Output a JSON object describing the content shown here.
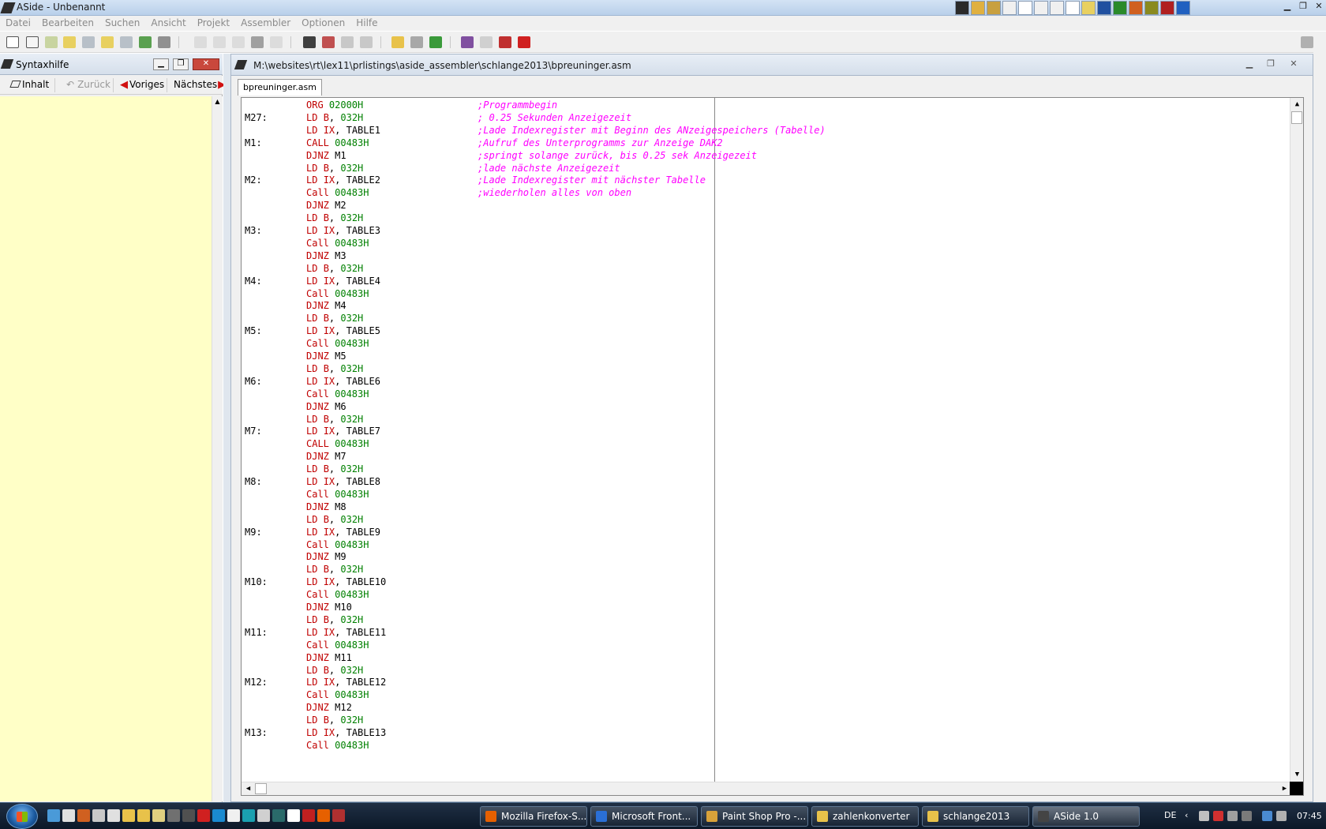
{
  "window": {
    "title": "ASide - Unbenannt"
  },
  "menu": [
    "Datei",
    "Bearbeiten",
    "Suchen",
    "Ansicht",
    "Projekt",
    "Assembler",
    "Optionen",
    "Hilfe"
  ],
  "left_panel": {
    "title": "Syntaxhilfe",
    "buttons": {
      "contents": "Inhalt",
      "back": "Zurück",
      "previous": "Voriges",
      "next": "Nächstes"
    }
  },
  "editor": {
    "path": "M:\\websites\\rt\\lex11\\prlistings\\aside_assembler\\schlange2013\\bpreuninger.asm",
    "tab": "bpreuninger.asm",
    "lines": [
      {
        "label": "",
        "op": "ORG",
        "args": [
          {
            "t": "02000H",
            "c": "num"
          }
        ],
        "comment": ";Programmbegin"
      },
      {
        "label": "M27:",
        "op": "LD",
        "args": [
          {
            "t": "B",
            "c": "reg"
          },
          {
            "t": ", ",
            "c": "plain"
          },
          {
            "t": "032H",
            "c": "num"
          }
        ],
        "comment": "; 0.25 Sekunden Anzeigezeit"
      },
      {
        "label": "",
        "op": "LD",
        "args": [
          {
            "t": "IX",
            "c": "reg"
          },
          {
            "t": ", TABLE1",
            "c": "plain"
          }
        ],
        "comment": ";Lade Indexregister mit Beginn des ANzeigespeichers (Tabelle)"
      },
      {
        "label": "M1:",
        "op": "CALL",
        "args": [
          {
            "t": "00483H",
            "c": "num"
          }
        ],
        "comment": ";Aufruf des Unterprogramms zur Anzeige DAK2"
      },
      {
        "label": "",
        "op": "DJNZ",
        "args": [
          {
            "t": "M1",
            "c": "plain"
          }
        ],
        "comment": ";springt solange zurück, bis 0.25 sek Anzeigezeit"
      },
      {
        "label": "",
        "op": "LD",
        "args": [
          {
            "t": "B",
            "c": "reg"
          },
          {
            "t": ", ",
            "c": "plain"
          },
          {
            "t": "032H",
            "c": "num"
          }
        ],
        "comment": ";lade nächste Anzeigezeit"
      },
      {
        "label": "M2:",
        "op": "LD",
        "args": [
          {
            "t": "IX",
            "c": "reg"
          },
          {
            "t": ", TABLE2",
            "c": "plain"
          }
        ],
        "comment": ";Lade Indexregister mit nächster Tabelle"
      },
      {
        "label": "",
        "op": "Call",
        "args": [
          {
            "t": "00483H",
            "c": "num"
          }
        ],
        "comment": ";wiederholen alles von oben"
      },
      {
        "label": "",
        "op": "DJNZ",
        "args": [
          {
            "t": "M2",
            "c": "plain"
          }
        ],
        "comment": ""
      },
      {
        "label": "",
        "op": "LD",
        "args": [
          {
            "t": "B",
            "c": "reg"
          },
          {
            "t": ", ",
            "c": "plain"
          },
          {
            "t": "032H",
            "c": "num"
          }
        ],
        "comment": ""
      },
      {
        "label": "M3:",
        "op": "LD",
        "args": [
          {
            "t": "IX",
            "c": "reg"
          },
          {
            "t": ", TABLE3",
            "c": "plain"
          }
        ],
        "comment": ""
      },
      {
        "label": "",
        "op": "Call",
        "args": [
          {
            "t": "00483H",
            "c": "num"
          }
        ],
        "comment": ""
      },
      {
        "label": "",
        "op": "DJNZ",
        "args": [
          {
            "t": "M3",
            "c": "plain"
          }
        ],
        "comment": ""
      },
      {
        "label": "",
        "op": "LD",
        "args": [
          {
            "t": "B",
            "c": "reg"
          },
          {
            "t": ", ",
            "c": "plain"
          },
          {
            "t": "032H",
            "c": "num"
          }
        ],
        "comment": ""
      },
      {
        "label": "M4:",
        "op": "LD",
        "args": [
          {
            "t": "IX",
            "c": "reg"
          },
          {
            "t": ", TABLE4",
            "c": "plain"
          }
        ],
        "comment": ""
      },
      {
        "label": "",
        "op": "Call",
        "args": [
          {
            "t": "00483H",
            "c": "num"
          }
        ],
        "comment": ""
      },
      {
        "label": "",
        "op": "DJNZ",
        "args": [
          {
            "t": "M4",
            "c": "plain"
          }
        ],
        "comment": ""
      },
      {
        "label": "",
        "op": "LD",
        "args": [
          {
            "t": "B",
            "c": "reg"
          },
          {
            "t": ", ",
            "c": "plain"
          },
          {
            "t": "032H",
            "c": "num"
          }
        ],
        "comment": ""
      },
      {
        "label": "M5:",
        "op": "LD",
        "args": [
          {
            "t": "IX",
            "c": "reg"
          },
          {
            "t": ", TABLE5",
            "c": "plain"
          }
        ],
        "comment": ""
      },
      {
        "label": "",
        "op": "Call",
        "args": [
          {
            "t": "00483H",
            "c": "num"
          }
        ],
        "comment": ""
      },
      {
        "label": "",
        "op": "DJNZ",
        "args": [
          {
            "t": "M5",
            "c": "plain"
          }
        ],
        "comment": ""
      },
      {
        "label": "",
        "op": "LD",
        "args": [
          {
            "t": "B",
            "c": "reg"
          },
          {
            "t": ", ",
            "c": "plain"
          },
          {
            "t": "032H",
            "c": "num"
          }
        ],
        "comment": ""
      },
      {
        "label": "M6:",
        "op": "LD",
        "args": [
          {
            "t": "IX",
            "c": "reg"
          },
          {
            "t": ", TABLE6",
            "c": "plain"
          }
        ],
        "comment": ""
      },
      {
        "label": "",
        "op": "Call",
        "args": [
          {
            "t": "00483H",
            "c": "num"
          }
        ],
        "comment": ""
      },
      {
        "label": "",
        "op": "DJNZ",
        "args": [
          {
            "t": "M6",
            "c": "plain"
          }
        ],
        "comment": ""
      },
      {
        "label": "",
        "op": "LD",
        "args": [
          {
            "t": "B",
            "c": "reg"
          },
          {
            "t": ", ",
            "c": "plain"
          },
          {
            "t": "032H",
            "c": "num"
          }
        ],
        "comment": ""
      },
      {
        "label": "M7:",
        "op": "LD",
        "args": [
          {
            "t": "IX",
            "c": "reg"
          },
          {
            "t": ", TABLE7",
            "c": "plain"
          }
        ],
        "comment": ""
      },
      {
        "label": "",
        "op": "CALL",
        "args": [
          {
            "t": "00483H",
            "c": "num"
          }
        ],
        "comment": ""
      },
      {
        "label": "",
        "op": "DJNZ",
        "args": [
          {
            "t": "M7",
            "c": "plain"
          }
        ],
        "comment": ""
      },
      {
        "label": "",
        "op": "LD",
        "args": [
          {
            "t": "B",
            "c": "reg"
          },
          {
            "t": ", ",
            "c": "plain"
          },
          {
            "t": "032H",
            "c": "num"
          }
        ],
        "comment": ""
      },
      {
        "label": "M8:",
        "op": "LD",
        "args": [
          {
            "t": "IX",
            "c": "reg"
          },
          {
            "t": ", TABLE8",
            "c": "plain"
          }
        ],
        "comment": ""
      },
      {
        "label": "",
        "op": "Call",
        "args": [
          {
            "t": "00483H",
            "c": "num"
          }
        ],
        "comment": ""
      },
      {
        "label": "",
        "op": "DJNZ",
        "args": [
          {
            "t": "M8",
            "c": "plain"
          }
        ],
        "comment": ""
      },
      {
        "label": "",
        "op": "LD",
        "args": [
          {
            "t": "B",
            "c": "reg"
          },
          {
            "t": ", ",
            "c": "plain"
          },
          {
            "t": "032H",
            "c": "num"
          }
        ],
        "comment": ""
      },
      {
        "label": "M9:",
        "op": "LD",
        "args": [
          {
            "t": "IX",
            "c": "reg"
          },
          {
            "t": ", TABLE9",
            "c": "plain"
          }
        ],
        "comment": ""
      },
      {
        "label": "",
        "op": "Call",
        "args": [
          {
            "t": "00483H",
            "c": "num"
          }
        ],
        "comment": ""
      },
      {
        "label": "",
        "op": "DJNZ",
        "args": [
          {
            "t": "M9",
            "c": "plain"
          }
        ],
        "comment": ""
      },
      {
        "label": "",
        "op": "LD",
        "args": [
          {
            "t": "B",
            "c": "reg"
          },
          {
            "t": ", ",
            "c": "plain"
          },
          {
            "t": "032H",
            "c": "num"
          }
        ],
        "comment": ""
      },
      {
        "label": "M10:",
        "op": "LD",
        "args": [
          {
            "t": "IX",
            "c": "reg"
          },
          {
            "t": ", TABLE10",
            "c": "plain"
          }
        ],
        "comment": ""
      },
      {
        "label": "",
        "op": "Call",
        "args": [
          {
            "t": "00483H",
            "c": "num"
          }
        ],
        "comment": ""
      },
      {
        "label": "",
        "op": "DJNZ",
        "args": [
          {
            "t": "M10",
            "c": "plain"
          }
        ],
        "comment": ""
      },
      {
        "label": "",
        "op": "LD",
        "args": [
          {
            "t": "B",
            "c": "reg"
          },
          {
            "t": ", ",
            "c": "plain"
          },
          {
            "t": "032H",
            "c": "num"
          }
        ],
        "comment": ""
      },
      {
        "label": "M11:",
        "op": "LD",
        "args": [
          {
            "t": "IX",
            "c": "reg"
          },
          {
            "t": ", TABLE11",
            "c": "plain"
          }
        ],
        "comment": ""
      },
      {
        "label": "",
        "op": "Call",
        "args": [
          {
            "t": "00483H",
            "c": "num"
          }
        ],
        "comment": ""
      },
      {
        "label": "",
        "op": "DJNZ",
        "args": [
          {
            "t": "M11",
            "c": "plain"
          }
        ],
        "comment": ""
      },
      {
        "label": "",
        "op": "LD",
        "args": [
          {
            "t": "B",
            "c": "reg"
          },
          {
            "t": ", ",
            "c": "plain"
          },
          {
            "t": "032H",
            "c": "num"
          }
        ],
        "comment": ""
      },
      {
        "label": "M12:",
        "op": "LD",
        "args": [
          {
            "t": "IX",
            "c": "reg"
          },
          {
            "t": ", TABLE12",
            "c": "plain"
          }
        ],
        "comment": ""
      },
      {
        "label": "",
        "op": "Call",
        "args": [
          {
            "t": "00483H",
            "c": "num"
          }
        ],
        "comment": ""
      },
      {
        "label": "",
        "op": "DJNZ",
        "args": [
          {
            "t": "M12",
            "c": "plain"
          }
        ],
        "comment": ""
      },
      {
        "label": "",
        "op": "LD",
        "args": [
          {
            "t": "B",
            "c": "reg"
          },
          {
            "t": ", ",
            "c": "plain"
          },
          {
            "t": "032H",
            "c": "num"
          }
        ],
        "comment": ""
      },
      {
        "label": "M13:",
        "op": "LD",
        "args": [
          {
            "t": "IX",
            "c": "reg"
          },
          {
            "t": ", TABLE13",
            "c": "plain"
          }
        ],
        "comment": ""
      },
      {
        "label": "",
        "op": "Call",
        "args": [
          {
            "t": "00483H",
            "c": "num"
          }
        ],
        "comment": ""
      }
    ]
  },
  "taskbar": {
    "tasks": [
      {
        "label": "Mozilla Firefox-S...",
        "icon": "firefox-icon",
        "color": "#e66000"
      },
      {
        "label": "Microsoft Front...",
        "icon": "frontpage-icon",
        "color": "#2a6fd6"
      },
      {
        "label": "Paint Shop Pro -...",
        "icon": "paintshop-icon",
        "color": "#d8a23a"
      },
      {
        "label": "zahlenkonverter",
        "icon": "folder-icon",
        "color": "#e8c24a"
      },
      {
        "label": "schlange2013",
        "icon": "folder-icon",
        "color": "#e8c24a"
      },
      {
        "label": "ASide 1.0",
        "icon": "aside-icon",
        "color": "#444444"
      }
    ],
    "language": "DE",
    "clock": "07:45"
  },
  "colors": {
    "keyword": "#c00000",
    "number": "#008000",
    "comment": "#ff00ff",
    "help_background": "#ffffc7"
  }
}
